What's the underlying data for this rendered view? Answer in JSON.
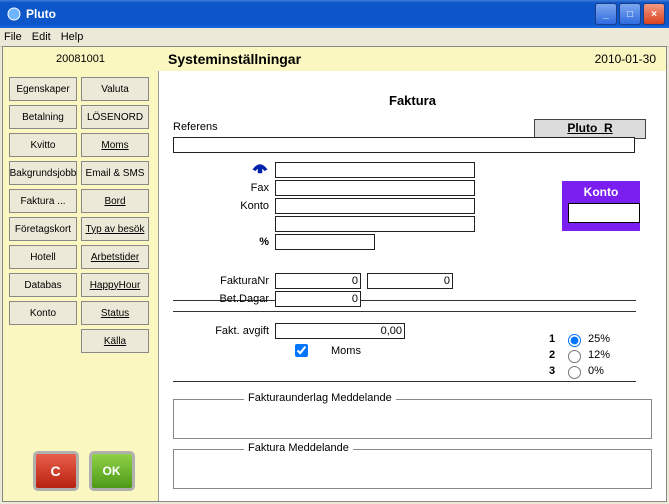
{
  "window": {
    "title": "Pluto",
    "menu": {
      "file": "File",
      "edit": "Edit",
      "help": "Help"
    },
    "buttons": {
      "min": "_",
      "max": "□",
      "close": "×"
    }
  },
  "header": {
    "left": "20081001",
    "title": "Systeminställningar",
    "date": "2010-01-30"
  },
  "sidebar": {
    "rows": [
      [
        "Egenskaper",
        "Valuta"
      ],
      [
        "Betalning",
        "LÖSENORD"
      ],
      [
        "Kvitto",
        "Moms"
      ],
      [
        "Bakgrundsjobb",
        "Email & SMS"
      ],
      [
        "Faktura ...",
        "Bord"
      ],
      [
        "Företagskort",
        "Typ av besök"
      ],
      [
        "Hotell",
        "Arbetstider"
      ],
      [
        "Databas",
        "HappyHour"
      ],
      [
        "Konto",
        "Status"
      ],
      [
        "",
        "Källa"
      ]
    ],
    "cancel": "C",
    "ok": "OK"
  },
  "main": {
    "section_title": "Faktura",
    "referens_label": "Referens",
    "referens_value": "",
    "ref_btn": "Pluto_R",
    "phone_value": "",
    "fax_label": "Fax",
    "fax_value": "",
    "konto_label": "Konto",
    "konto_value": "",
    "blank_value": "",
    "pct_label": "%",
    "pct_value": "",
    "fakturanr_label": "FakturaNr",
    "fakturanr_value": "0",
    "fakturanr2_value": "0",
    "betdagar_label": "Bet.Dagar",
    "betdagar_value": "0",
    "faktavgift_label": "Fakt. avgift",
    "faktavgift_value": "0,00",
    "moms_check_label": "Moms",
    "moms_checked": true,
    "moms_options": [
      {
        "n": "1",
        "label": "25%",
        "selected": true
      },
      {
        "n": "2",
        "label": "12%",
        "selected": false
      },
      {
        "n": "3",
        "label": "0%",
        "selected": false
      }
    ],
    "fieldset1": "Fakturaunderlag Meddelande",
    "fieldset2": "Faktura Meddelande",
    "konto_box": {
      "title": "Konto",
      "value": ""
    }
  }
}
